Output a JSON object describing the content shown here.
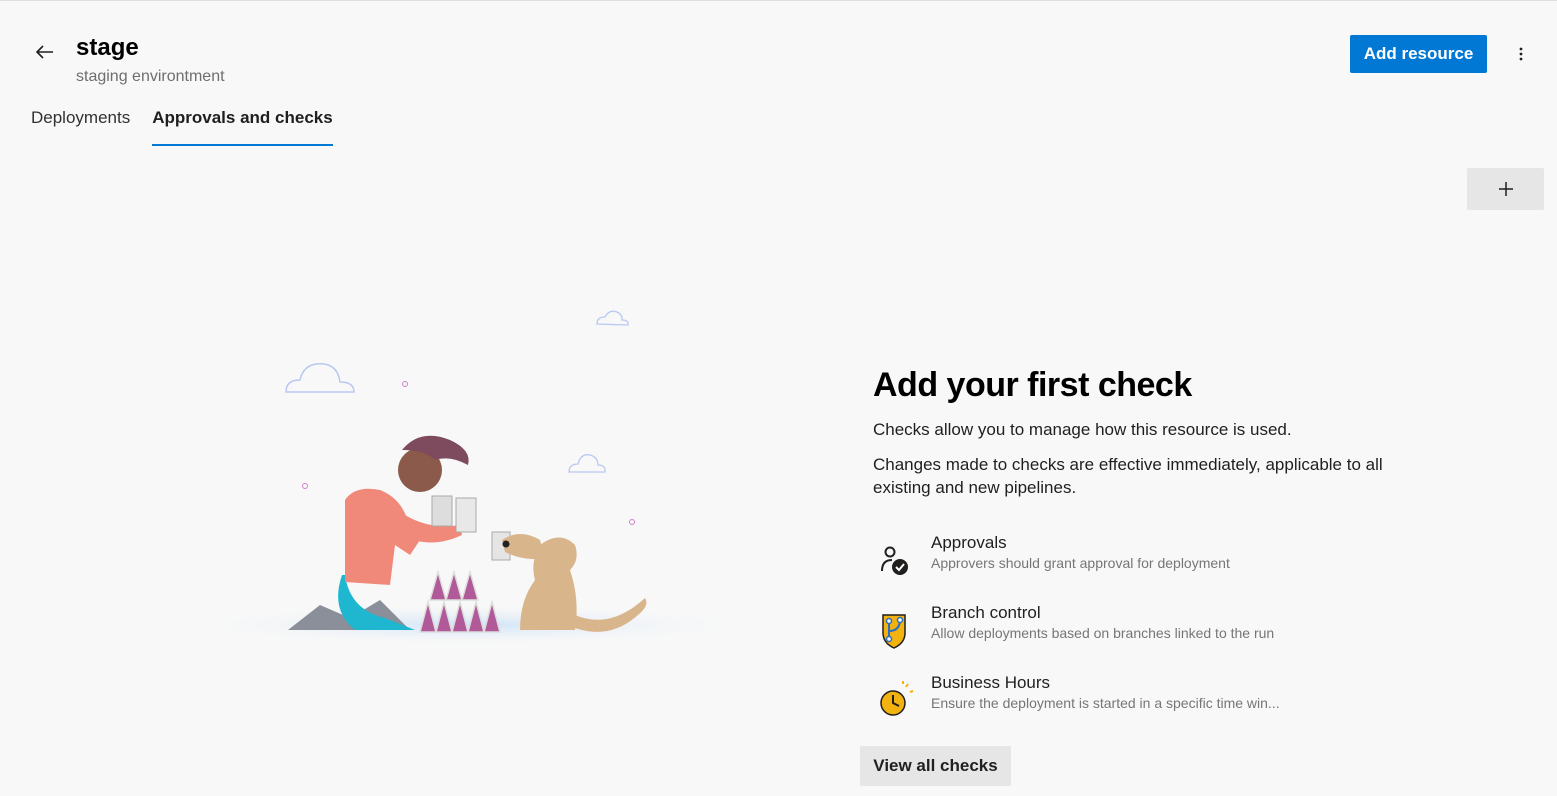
{
  "header": {
    "title": "stage",
    "subtitle": "staging environtment",
    "add_resource_label": "Add resource"
  },
  "tabs": [
    {
      "label": "Deployments",
      "active": false
    },
    {
      "label": "Approvals and checks",
      "active": true
    }
  ],
  "empty_state": {
    "heading": "Add your first check",
    "description_1": "Checks allow you to manage how this resource is used.",
    "description_2": "Changes made to checks are effective immediately, applicable to all existing and new pipelines.",
    "checks": [
      {
        "name": "Approvals",
        "description": "Approvers should grant approval for deployment",
        "icon": "approvals-icon"
      },
      {
        "name": "Branch control",
        "description": "Allow deployments based on branches linked to the run",
        "icon": "branch-control-icon"
      },
      {
        "name": "Business Hours",
        "description": "Ensure the deployment is started in a specific time win...",
        "icon": "business-hours-icon"
      }
    ],
    "view_all_label": "View all checks"
  },
  "colors": {
    "accent": "#0078d4",
    "background": "#f8f8f8",
    "secondary_button": "#e6e6e6"
  },
  "icons": {
    "back": "back-arrow-icon",
    "more": "more-vertical-icon",
    "add": "plus-icon"
  }
}
